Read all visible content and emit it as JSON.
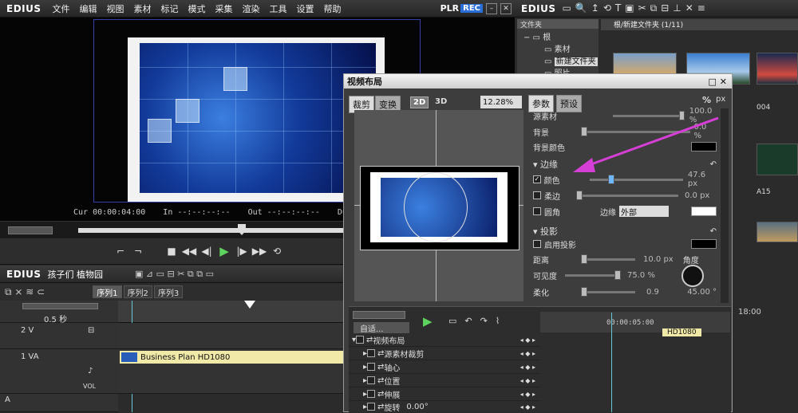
{
  "menubar": {
    "logo": "EDIUS",
    "items": [
      "文件",
      "编辑",
      "视图",
      "素材",
      "标记",
      "模式",
      "采集",
      "渲染",
      "工具",
      "设置",
      "帮助"
    ],
    "plr": "PLR",
    "rec": "REC"
  },
  "preview": {
    "cur_label": "Cur",
    "cur_value": "00:00:04:00",
    "in_label": "In",
    "in_value": "--:--:--:--",
    "out_label": "Out",
    "out_value": "--:--:--:--",
    "dur_label": "Dur",
    "dur_value": "--:--:--:--"
  },
  "timeline": {
    "logo": "EDIUS",
    "project": "孩子们 植物园",
    "sequences": [
      "序列1",
      "序列2",
      "序列3"
    ],
    "scale": "0.5 秒",
    "track_v": "2 V",
    "track_va": "1 VA",
    "track_a": "A",
    "vol_label": "VOL",
    "clip_name": "Business Plan HD1080",
    "time_right": "18:00"
  },
  "browser": {
    "logo": "EDIUS",
    "tree_header": "文件夹",
    "tree_root": "根",
    "tree_items": [
      "素材",
      "新建文件夹",
      "照片"
    ],
    "path": "根/新建文件夹 (1/11)",
    "thumb_label_1": "004",
    "thumb_label_2": "A15"
  },
  "dialog": {
    "title": "视频布局",
    "tab_crop": "裁剪",
    "tab_transform": "变换",
    "btn_2d": "2D",
    "btn_3d": "3D",
    "zoom": "12.28%",
    "tab_params": "参数",
    "tab_presets": "预设",
    "unit_percent": "%",
    "unit_px": "px",
    "source": "源素材",
    "source_val": "100.0 %",
    "background": "背景",
    "background_val": "0.0 %",
    "bg_color": "背景颜色",
    "border": "边缘",
    "color": "颜色",
    "color_val": "47.6 px",
    "soft_edge": "柔边",
    "soft_val": "0.0 px",
    "rounded": "圆角",
    "border_label": "边缘",
    "border_option": "外部",
    "shadow": "投影",
    "enable_shadow": "启用投影",
    "distance": "距离",
    "distance_val": "10.0 px",
    "visibility": "可见度",
    "visibility_val": "75.0 %",
    "softness": "柔化",
    "softness_val": "0.9",
    "angle": "角度",
    "angle_val": "45.00 °",
    "kf_auto": "自适...",
    "kf_root": "视频布局",
    "kf_items": [
      "源素材裁剪",
      "轴心",
      "位置",
      "伸展",
      "旋转"
    ],
    "kf_rotation_val": "0.00°",
    "kf_time": "00:00:05:00",
    "kf_clip": "HD1080"
  },
  "colors": {
    "accent_blue": "#2a6fd8",
    "clip_yellow": "#f1e9a8",
    "play_green": "#5fd35f",
    "arrow_magenta": "#d63fd6"
  }
}
